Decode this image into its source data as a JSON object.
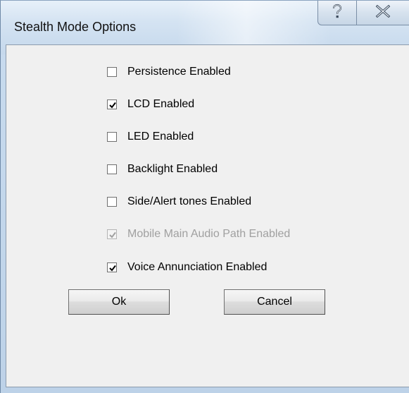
{
  "window": {
    "title": "Stealth Mode Options",
    "help_icon": "help-question-icon",
    "close_icon": "close-x-icon"
  },
  "options": [
    {
      "label": "Persistence Enabled",
      "checked": false,
      "enabled": true
    },
    {
      "label": "LCD Enabled",
      "checked": true,
      "enabled": true
    },
    {
      "label": "LED Enabled",
      "checked": false,
      "enabled": true
    },
    {
      "label": "Backlight Enabled",
      "checked": false,
      "enabled": true
    },
    {
      "label": "Side/Alert tones Enabled",
      "checked": false,
      "enabled": true
    },
    {
      "label": "Mobile Main Audio Path Enabled",
      "checked": true,
      "enabled": false
    },
    {
      "label": "Voice Annunciation Enabled",
      "checked": true,
      "enabled": true
    }
  ],
  "buttons": {
    "ok_label": "Ok",
    "cancel_label": "Cancel"
  }
}
